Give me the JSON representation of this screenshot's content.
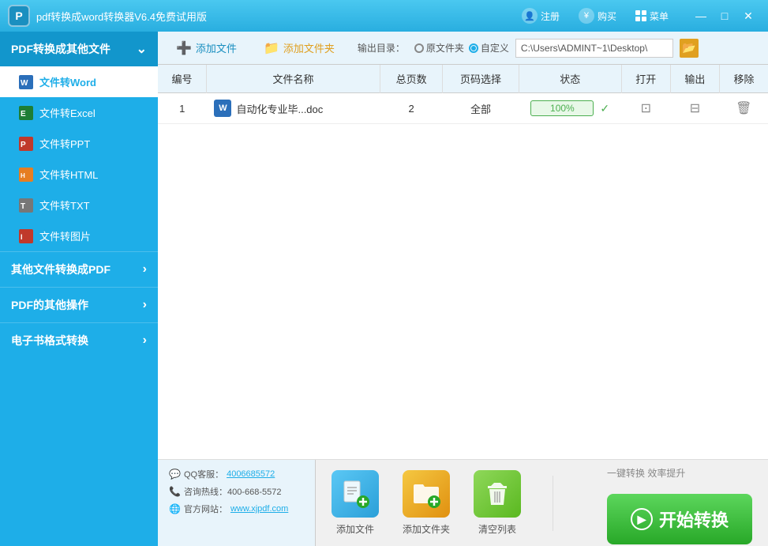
{
  "app": {
    "title": "pdf转换成word转换器V6.4免费试用版",
    "icon_label": "P"
  },
  "title_bar": {
    "register_label": "注册",
    "buy_label": "购买",
    "menu_label": "菜单"
  },
  "toolbar": {
    "add_file_label": "添加文件",
    "add_folder_label": "添加文件夹",
    "output_label": "输出目录：",
    "original_radio": "原文件夹",
    "custom_radio": "自定义",
    "output_path": "C:\\Users\\ADMINT~1\\Desktop\\",
    "browse_icon": "📁"
  },
  "table": {
    "headers": [
      "编号",
      "文件名称",
      "总页数",
      "页码选择",
      "状态",
      "打开",
      "输出",
      "移除"
    ],
    "rows": [
      {
        "num": "1",
        "filename": "自动化专业毕...doc",
        "pages": "2",
        "page_select": "全部",
        "status": "100%",
        "open_icon": "🔲",
        "output_icon": "⊟",
        "remove_icon": "🗑"
      }
    ]
  },
  "bottom": {
    "qq_label": "QQ客服：",
    "qq_number": "4006685572",
    "phone_label": "咨询热线：400-668-5572",
    "website_label": "官方网站：",
    "website_url": "www.xjpdf.com",
    "add_file_label": "添加文件",
    "add_folder_label": "添加文件夹",
    "clear_label": "清空列表",
    "tagline": "一键转换  效率提升",
    "start_label": "开始转换"
  },
  "sidebar": {
    "main_section": "PDF转换成其他文件",
    "items": [
      {
        "label": "文件转Word",
        "active": true,
        "icon": "W"
      },
      {
        "label": "文件转Excel",
        "active": false,
        "icon": "E"
      },
      {
        "label": "文件转PPT",
        "active": false,
        "icon": "P"
      },
      {
        "label": "文件转HTML",
        "active": false,
        "icon": "H"
      },
      {
        "label": "文件转TXT",
        "active": false,
        "icon": "T"
      },
      {
        "label": "文件转图片",
        "active": false,
        "icon": "I"
      }
    ],
    "other_sections": [
      "其他文件转换成PDF",
      "PDF的其他操作",
      "电子书格式转换"
    ]
  }
}
